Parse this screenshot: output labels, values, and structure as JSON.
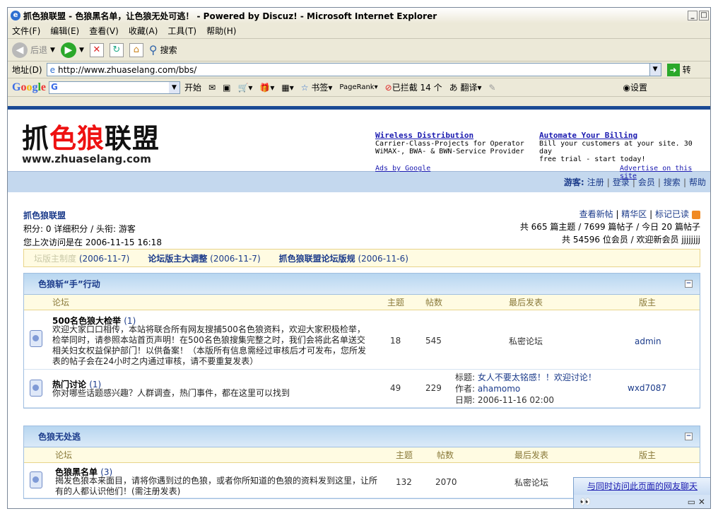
{
  "window": {
    "title": "抓色狼联盟 - 色狼黑名单，让色狼无处可逃！ - Powered by Discuz! - Microsoft Internet Explorer",
    "ie_icon": "ie-logo-icon",
    "controls": [
      "_",
      "□"
    ]
  },
  "menu": [
    "文件(F)",
    "编辑(E)",
    "查看(V)",
    "收藏(A)",
    "工具(T)",
    "帮助(H)"
  ],
  "toolbar": {
    "back_label": "后退",
    "search_label": "搜索"
  },
  "address": {
    "label": "地址(D)",
    "url": "http://www.zhuaselang.com/bbs/",
    "go_label": "转"
  },
  "googlebar": {
    "logo": "Google",
    "start_label": "开始",
    "bookmark_label": "书签",
    "pagerank_label": "PageRank",
    "blocked_label": "已拦截 14 个",
    "translate_label": "翻译",
    "settings_label": "设置"
  },
  "site": {
    "logo_text": [
      "抓",
      "色狼",
      "联盟"
    ],
    "logo_url": "www.zhuaselang.com",
    "ads": [
      {
        "title": "Wireless Distribution",
        "line1": "Carrier-Class-Projects for Operator",
        "line2": "WiMAX-, BWA- & BWN-Service Provider"
      },
      {
        "title": "Automate Your Billing",
        "line1": "Bill your customers at your site. 30 day",
        "line2": "free trial - start today!"
      }
    ],
    "ads_by": "Ads by Google",
    "advertise": "Advertise on this site"
  },
  "nav": {
    "guest_label": "游客:",
    "links": [
      "注册",
      "登录",
      "会员",
      "搜索",
      "帮助"
    ]
  },
  "userinfo": {
    "forum_name": "抓色狼联盟",
    "points_line": "积分: 0 详细积分 / 头衔: 游客",
    "last_visit": "您上次访问是在 2006-11-15 16:18",
    "right_links": [
      "查看新帖",
      "精华区",
      "标记已读"
    ],
    "stats1": "共 665 篇主题 / 7699 篇帖子 / 今日 20 篇帖子",
    "stats2": "共 54596 位会员 / 欢迎新会员 jjjjjjjj"
  },
  "announcements": [
    {
      "title": "坛版主制度",
      "date": "(2006-11-7)"
    },
    {
      "title": "论坛版主大调整",
      "date": "(2006-11-7)"
    },
    {
      "title": "抓色狼联盟论坛版规",
      "date": "(2006-11-6)"
    }
  ],
  "sections": [
    {
      "title": "色狼斩“手”行动",
      "cols": {
        "forum": "论坛",
        "topics": "主题",
        "posts": "帖数",
        "last": "最后发表",
        "mod": "版主"
      },
      "rows": [
        {
          "name": "500名色狼大检举",
          "count": "(1)",
          "desc": "欢迎大家口口相传，本站将联合所有网友搜捕500名色狼资料，欢迎大家积极检举，检举同时，请参照本站首页声明！在500名色狼搜集完整之时，我们会将此名单送交相关妇女权益保护部门！以供备案！（本版所有信息需经过审核后才可发布，您所发表的帖子会在24小时之内通过审核，请不要重复发表）",
          "topics": "18",
          "posts": "545",
          "last": "私密论坛",
          "mod": "admin"
        },
        {
          "name": "热门讨论",
          "count": "(1)",
          "desc": "你对哪些话题感兴趣？人群调查，热门事件，都在这里可以找到",
          "topics": "49",
          "posts": "229",
          "last_title_label": "标题:",
          "last_title": "女人不要太铭感！！欢迎讨论！",
          "last_author_label": "作者:",
          "last_author": "ahamomo",
          "last_date": "日期: 2006-11-16 02:00",
          "mod": "wxd7087"
        }
      ]
    },
    {
      "title": "色狼无处逃",
      "cols": {
        "forum": "论坛",
        "topics": "主题",
        "posts": "帖数",
        "last": "最后发表",
        "mod": "版主"
      },
      "rows": [
        {
          "name": "色狼黑名单",
          "count": "(3)",
          "desc": "揭发色狼本来面目，请将你遇到过的色狼，或者你所知道的色狼的资料发到这里，让所有的人都认识他们！(需注册发表)",
          "topics": "132",
          "posts": "2070",
          "last": "私密论坛"
        }
      ]
    }
  ],
  "chat_popup": {
    "link": "与同时访问此页面的网友聊天",
    "eyes": "👀",
    "controls": "▭ ✕"
  }
}
